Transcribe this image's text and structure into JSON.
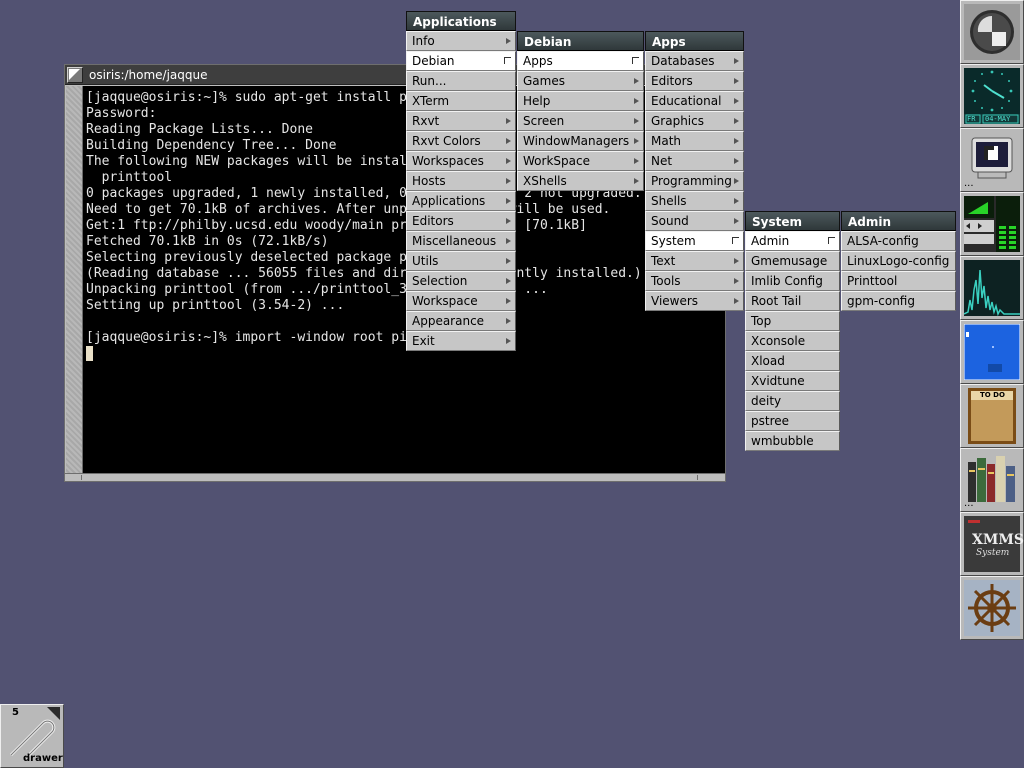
{
  "terminal": {
    "title": "osiris:/home/jaqque",
    "lines": [
      "[jaqque@osiris:~]% sudo apt-get install printtool",
      "Password:",
      "Reading Package Lists... Done",
      "Building Dependency Tree... Done",
      "The following NEW packages will be installed:",
      "  printtool",
      "0 packages upgraded, 1 newly installed, 0 to remove and 2 not upgraded.",
      "Need to get 70.1kB of archives. After unpacking 328kB will be used.",
      "Get:1 ftp://philby.ucsd.edu woody/main printtool 3.54-2 [70.1kB]",
      "Fetched 70.1kB in 0s (72.1kB/s)",
      "Selecting previously deselected package printtool.",
      "(Reading database ... 56055 files and directories currently installed.)",
      "Unpacking printtool (from .../printtool_3.54-2_all.deb) ...",
      "Setting up printtool (3.54-2) ...",
      "",
      "[jaqque@osiris:~]% import -window root pic.png"
    ]
  },
  "menus": {
    "applications": {
      "title": "Applications",
      "items": [
        {
          "label": "Info",
          "sub": true
        },
        {
          "label": "Debian",
          "sub": true,
          "selected": true
        },
        {
          "label": "Run...",
          "sub": false
        },
        {
          "label": "XTerm",
          "sub": false
        },
        {
          "label": "Rxvt",
          "sub": true
        },
        {
          "label": "Rxvt Colors",
          "sub": true
        },
        {
          "label": "Workspaces",
          "sub": true
        },
        {
          "label": "Hosts",
          "sub": true
        },
        {
          "label": "Applications",
          "sub": true
        },
        {
          "label": "Editors",
          "sub": true
        },
        {
          "label": "Miscellaneous",
          "sub": true
        },
        {
          "label": "Utils",
          "sub": true
        },
        {
          "label": "Selection",
          "sub": true
        },
        {
          "label": "Workspace",
          "sub": true
        },
        {
          "label": "Appearance",
          "sub": true
        },
        {
          "label": "Exit",
          "sub": true
        }
      ]
    },
    "debian": {
      "title": "Debian",
      "items": [
        {
          "label": "Apps",
          "sub": true,
          "selected": true
        },
        {
          "label": "Games",
          "sub": true
        },
        {
          "label": "Help",
          "sub": true
        },
        {
          "label": "Screen",
          "sub": true
        },
        {
          "label": "WindowManagers",
          "sub": true
        },
        {
          "label": "WorkSpace",
          "sub": true
        },
        {
          "label": "XShells",
          "sub": true
        }
      ]
    },
    "apps": {
      "title": "Apps",
      "items": [
        {
          "label": "Databases",
          "sub": true
        },
        {
          "label": "Editors",
          "sub": true
        },
        {
          "label": "Educational",
          "sub": true
        },
        {
          "label": "Graphics",
          "sub": true
        },
        {
          "label": "Math",
          "sub": true
        },
        {
          "label": "Net",
          "sub": true
        },
        {
          "label": "Programming",
          "sub": true
        },
        {
          "label": "Shells",
          "sub": true
        },
        {
          "label": "Sound",
          "sub": true
        },
        {
          "label": "System",
          "sub": true,
          "selected": true
        },
        {
          "label": "Text",
          "sub": true
        },
        {
          "label": "Tools",
          "sub": true
        },
        {
          "label": "Viewers",
          "sub": true
        }
      ]
    },
    "system": {
      "title": "System",
      "items": [
        {
          "label": "Admin",
          "sub": true,
          "selected": true
        },
        {
          "label": "Gmemusage",
          "sub": false
        },
        {
          "label": "Imlib Config",
          "sub": false
        },
        {
          "label": "Root Tail",
          "sub": false
        },
        {
          "label": "Top",
          "sub": false
        },
        {
          "label": "Xconsole",
          "sub": false
        },
        {
          "label": "Xload",
          "sub": false
        },
        {
          "label": "Xvidtune",
          "sub": false
        },
        {
          "label": "deity",
          "sub": false
        },
        {
          "label": "pstree",
          "sub": false
        },
        {
          "label": "wmbubble",
          "sub": false
        }
      ]
    },
    "admin": {
      "title": "Admin",
      "items": [
        {
          "label": "ALSA-config",
          "sub": false
        },
        {
          "label": "LinuxLogo-config",
          "sub": false
        },
        {
          "label": "Printtool",
          "sub": false
        },
        {
          "label": "gpm-config",
          "sub": false
        }
      ]
    }
  },
  "dock": {
    "clock": {
      "day": "FR",
      "date": "04-MAY"
    },
    "todo_label": "TO DO",
    "xmms_label": "XMMS",
    "xmms_sub": "System",
    "icons": [
      "windowmaker-logo-icon",
      "clock-icon",
      "terminal-monitor-icon",
      "mixer-icon",
      "cpu-graph-icon",
      "pager-icon",
      "todo-note-icon",
      "books-icon",
      "xmms-icon",
      "ship-wheel-icon"
    ]
  },
  "drawer": {
    "count": "5",
    "label": "drawer"
  },
  "colors": {
    "desktop": "#525272",
    "menu_title": "#3a4548",
    "menu_item": "#c6c6c6",
    "terminal_bg": "#000000"
  }
}
